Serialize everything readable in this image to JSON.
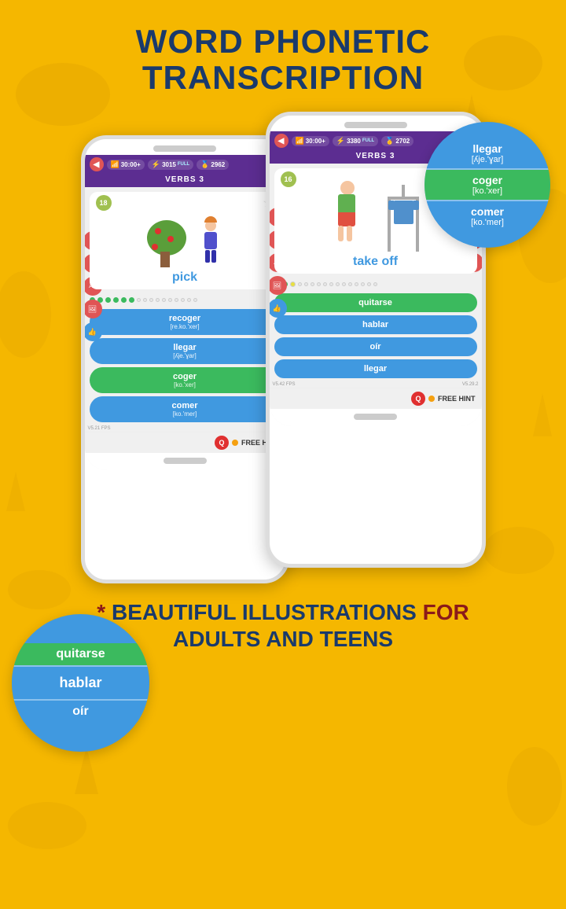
{
  "page": {
    "title": "WORD PHONETIC\nTRANSCRIPTION",
    "background_color": "#F5B700"
  },
  "bottom_text": {
    "line1": "* BEAUTIFUL ILLUSTRATIONS FOR",
    "line2": "ADULTS AND TEENS"
  },
  "phone_left": {
    "stats": {
      "time": "30:00+",
      "points": "3015",
      "full_label": "FULL",
      "coins": "2962"
    },
    "lesson": "VERBS 3",
    "card": {
      "badge": "18",
      "word": "pick",
      "fps": "V5.21 FPS",
      "version": "V5.29.2"
    },
    "answers": [
      {
        "word": "recoger",
        "phonetic": "[re.ko.'xer]",
        "style": "blue"
      },
      {
        "word": "llegar",
        "phonetic": "[ʎje.'ɣar]",
        "style": "blue"
      },
      {
        "word": "coger",
        "phonetic": "[ko.'xer]",
        "style": "green"
      },
      {
        "word": "comer",
        "phonetic": "[ko.'mer]",
        "style": "blue"
      }
    ],
    "hint": "FREE HINT"
  },
  "phone_right": {
    "stats": {
      "time": "30:00+",
      "points": "3380",
      "full_label": "FULL",
      "coins": "2702"
    },
    "lesson": "VERBS 3",
    "card": {
      "badge": "16",
      "word": "take off",
      "fps": "V5.42 FPS",
      "version": "V5.29.2"
    },
    "answers": [
      {
        "word": "quitarse",
        "style": "green"
      },
      {
        "word": "hablar",
        "style": "blue"
      },
      {
        "word": "oír",
        "style": "blue"
      },
      {
        "word": "llegar",
        "style": "blue"
      }
    ],
    "hint": "FREE HINT"
  },
  "callout_right": {
    "items": [
      {
        "word": "llegar",
        "phonetic": "[ʎje.'ɣar]",
        "style": "blue"
      },
      {
        "word": "coger",
        "phonetic": "[ko.'xer]",
        "style": "green"
      },
      {
        "word": "comer",
        "phonetic": "[ko.'mer]",
        "style": "blue"
      }
    ]
  },
  "callout_left": {
    "items": [
      {
        "word": "quitarse",
        "style": "green"
      },
      {
        "word": "hablar",
        "style": "blue"
      },
      {
        "word": "oír",
        "style": "blue"
      }
    ]
  },
  "icons": {
    "back": "◀",
    "wifi": "📶",
    "lightning": "⚡",
    "coin": "🥇",
    "star": "★",
    "scissors": "✂",
    "brightness": "☀",
    "font": "Aa",
    "image": "🖼",
    "thumb": "👍",
    "eye": "👁",
    "pause": "⏸",
    "mail": "✉",
    "hint_q": "Q"
  }
}
